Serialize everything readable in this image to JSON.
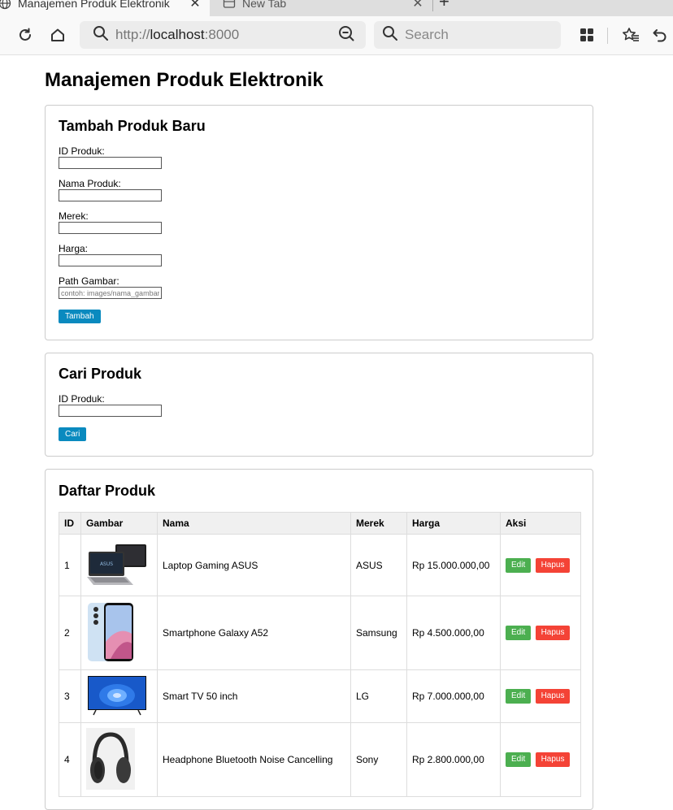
{
  "browser": {
    "tabs": [
      {
        "title": "Manajemen Produk Elektronik",
        "active": true
      },
      {
        "title": "New Tab",
        "active": false
      }
    ],
    "url_prefix": "http://",
    "url_host": "localhost",
    "url_port": ":8000",
    "search_placeholder": "Search"
  },
  "page": {
    "title": "Manajemen Produk Elektronik",
    "add_form": {
      "heading": "Tambah Produk Baru",
      "id_label": "ID Produk:",
      "name_label": "Nama Produk:",
      "brand_label": "Merek:",
      "price_label": "Harga:",
      "image_label": "Path Gambar:",
      "image_placeholder": "contoh: images/nama_gambar.jpg",
      "submit_label": "Tambah"
    },
    "search_form": {
      "heading": "Cari Produk",
      "id_label": "ID Produk:",
      "submit_label": "Cari"
    },
    "list": {
      "heading": "Daftar Produk",
      "columns": [
        "ID",
        "Gambar",
        "Nama",
        "Merek",
        "Harga",
        "Aksi"
      ],
      "edit_label": "Edit",
      "delete_label": "Hapus",
      "rows": [
        {
          "id": "1",
          "image": "laptop",
          "name": "Laptop Gaming ASUS",
          "brand": "ASUS",
          "price": "Rp 15.000.000,00"
        },
        {
          "id": "2",
          "image": "smartphone",
          "name": "Smartphone Galaxy A52",
          "brand": "Samsung",
          "price": "Rp 4.500.000,00"
        },
        {
          "id": "3",
          "image": "tv",
          "name": "Smart TV 50 inch",
          "brand": "LG",
          "price": "Rp 7.000.000,00"
        },
        {
          "id": "4",
          "image": "headphone",
          "name": "Headphone Bluetooth Noise Cancelling",
          "brand": "Sony",
          "price": "Rp 2.800.000,00"
        }
      ]
    }
  }
}
